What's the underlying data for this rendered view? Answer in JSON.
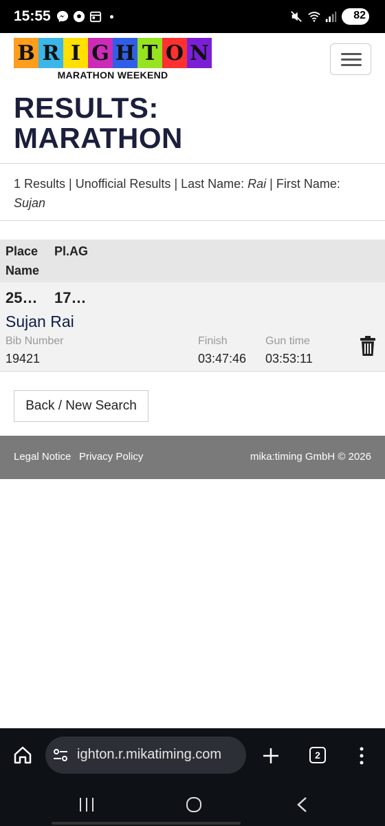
{
  "status_bar": {
    "time": "15:55",
    "battery": "82",
    "left_icons": [
      "messenger-icon",
      "soccer-ball-icon",
      "calendar-icon"
    ],
    "right_icons": [
      "mute-icon",
      "wifi-icon",
      "signal-icon",
      "battery-icon"
    ]
  },
  "header": {
    "logo_letters": [
      "B",
      "R",
      "I",
      "G",
      "H",
      "T",
      "O",
      "N"
    ],
    "logo_colors": [
      "#ff9d1d",
      "#3ab6e8",
      "#ffe000",
      "#cc2bb8",
      "#2f5fe6",
      "#96e31f",
      "#ff3030",
      "#7a1fd6"
    ],
    "logo_subtitle": "MARATHON WEEKEND",
    "menu_icon": "hamburger-icon"
  },
  "page": {
    "title_line1": "RESULTS:",
    "title_line2": "MARATHON"
  },
  "summary": {
    "text": "1 Results | Unofficial Results | Last Name: ",
    "last_name": "Rai",
    "mid": " | First Name: ",
    "first_name": "Sujan"
  },
  "table": {
    "headers": {
      "place": "Place",
      "name": "Name",
      "plag": "Pl.AG"
    },
    "rows": [
      {
        "place": "25…",
        "plag": "17…",
        "name": "Sujan Rai",
        "bib_label": "Bib Number",
        "bib": "19421",
        "finish_label": "Finish",
        "finish": "03:47:46",
        "gun_label": "Gun time",
        "gun": "03:53:11",
        "action_icon": "trash-icon"
      }
    ]
  },
  "back_button": "Back / New Search",
  "footer": {
    "legal": "Legal Notice",
    "privacy": "Privacy Policy",
    "copyright": "mika:timing GmbH © 2026"
  },
  "browser": {
    "url": "ighton.r.mikatiming.com",
    "tab_count": "2",
    "icons": [
      "home-icon",
      "site-settings-icon",
      "new-tab-icon",
      "tabs-icon",
      "more-icon",
      "recents-icon",
      "home-nav-icon",
      "back-nav-icon"
    ]
  }
}
